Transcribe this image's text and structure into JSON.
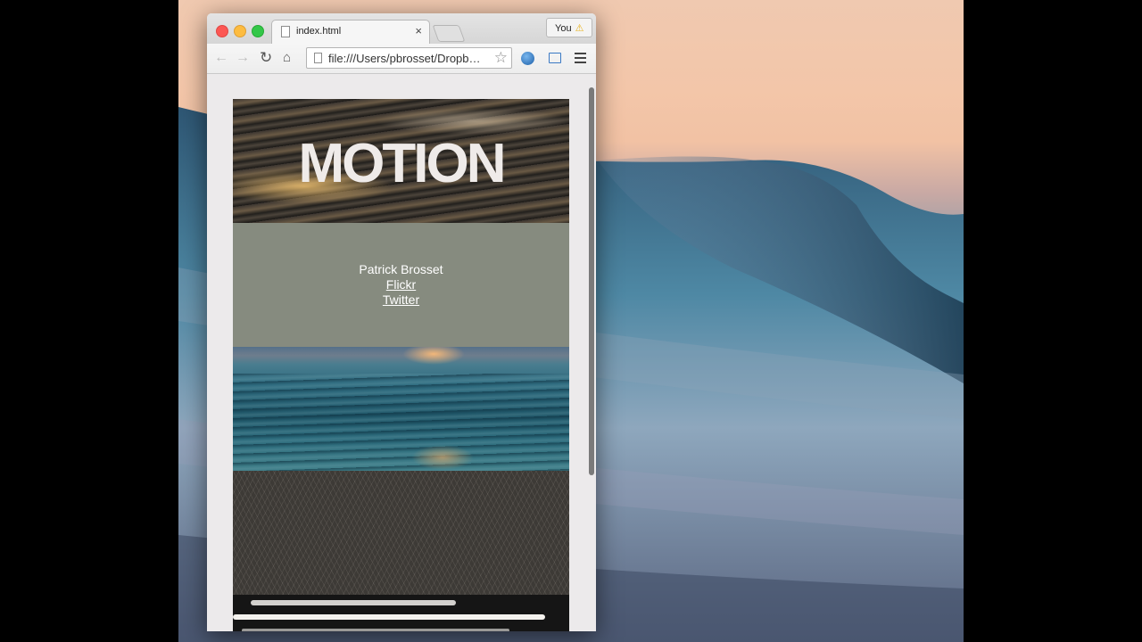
{
  "browser": {
    "tab_title": "index.html",
    "tab_close": "×",
    "profile_label": "You",
    "profile_warning": "⚠",
    "url": "file:///Users/pbrosset/Dropb…",
    "icons": {
      "back": "back-arrow-icon",
      "forward": "forward-arrow-icon",
      "reload": "reload-icon",
      "home": "home-icon",
      "bookmark": "star-icon",
      "menu": "hamburger-menu-icon"
    }
  },
  "page": {
    "hero_title": "MOTION",
    "author_name": "Patrick Brosset",
    "links": [
      "Flickr",
      "Twitter"
    ]
  },
  "colors": {
    "author_block_bg": "#868b7f",
    "hero_text": "#efebe9"
  }
}
